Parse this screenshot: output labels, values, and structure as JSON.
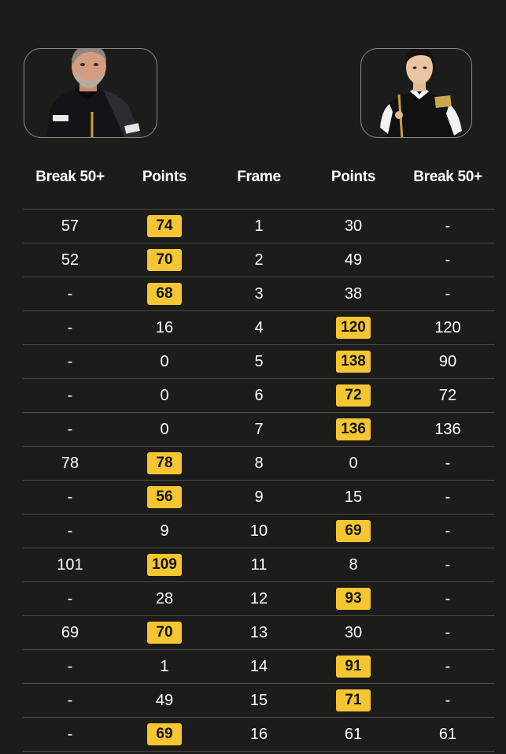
{
  "players": {
    "left": {
      "avatar": "player-photo-left"
    },
    "right": {
      "avatar": "player-photo-right"
    }
  },
  "headers": {
    "left_break": "Break 50+",
    "left_points": "Points",
    "frame": "Frame",
    "right_points": "Points",
    "right_break": "Break 50+"
  },
  "colors": {
    "background": "#1c1c1a",
    "winner_highlight": "#f5c631",
    "divider": "#4a4a47"
  },
  "frames": [
    {
      "lb": "57",
      "lp": "74",
      "frame": "1",
      "rp": "30",
      "rb": "-",
      "winner": "left"
    },
    {
      "lb": "52",
      "lp": "70",
      "frame": "2",
      "rp": "49",
      "rb": "-",
      "winner": "left"
    },
    {
      "lb": "-",
      "lp": "68",
      "frame": "3",
      "rp": "38",
      "rb": "-",
      "winner": "left"
    },
    {
      "lb": "-",
      "lp": "16",
      "frame": "4",
      "rp": "120",
      "rb": "120",
      "winner": "right"
    },
    {
      "lb": "-",
      "lp": "0",
      "frame": "5",
      "rp": "138",
      "rb": "90",
      "winner": "right"
    },
    {
      "lb": "-",
      "lp": "0",
      "frame": "6",
      "rp": "72",
      "rb": "72",
      "winner": "right"
    },
    {
      "lb": "-",
      "lp": "0",
      "frame": "7",
      "rp": "136",
      "rb": "136",
      "winner": "right"
    },
    {
      "lb": "78",
      "lp": "78",
      "frame": "8",
      "rp": "0",
      "rb": "-",
      "winner": "left"
    },
    {
      "lb": "-",
      "lp": "56",
      "frame": "9",
      "rp": "15",
      "rb": "-",
      "winner": "left"
    },
    {
      "lb": "-",
      "lp": "9",
      "frame": "10",
      "rp": "69",
      "rb": "-",
      "winner": "right"
    },
    {
      "lb": "101",
      "lp": "109",
      "frame": "11",
      "rp": "8",
      "rb": "-",
      "winner": "left"
    },
    {
      "lb": "-",
      "lp": "28",
      "frame": "12",
      "rp": "93",
      "rb": "-",
      "winner": "right"
    },
    {
      "lb": "69",
      "lp": "70",
      "frame": "13",
      "rp": "30",
      "rb": "-",
      "winner": "left"
    },
    {
      "lb": "-",
      "lp": "1",
      "frame": "14",
      "rp": "91",
      "rb": "-",
      "winner": "right"
    },
    {
      "lb": "-",
      "lp": "49",
      "frame": "15",
      "rp": "71",
      "rb": "-",
      "winner": "right"
    },
    {
      "lb": "-",
      "lp": "69",
      "frame": "16",
      "rp": "61",
      "rb": "61",
      "winner": "left"
    }
  ]
}
